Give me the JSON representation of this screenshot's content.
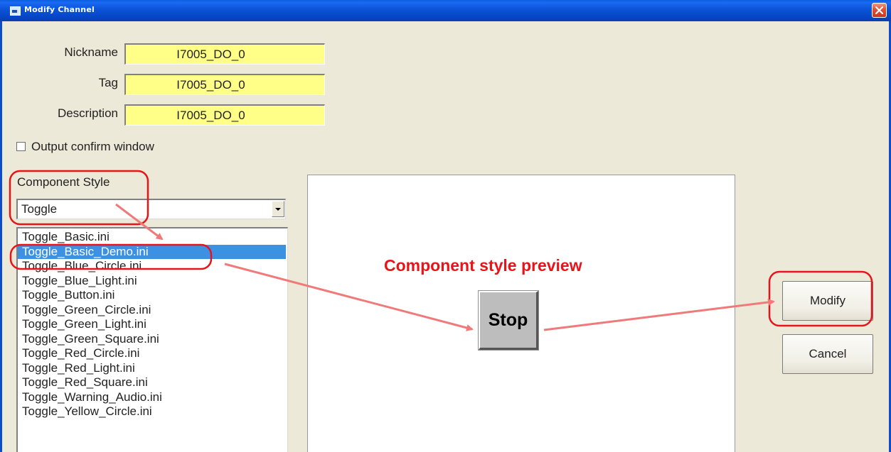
{
  "window": {
    "title": "Modify Channel"
  },
  "fields": {
    "nickname_label": "Nickname",
    "nickname_value": "I7005_DO_0",
    "tag_label": "Tag",
    "tag_value": "I7005_DO_0",
    "description_label": "Description",
    "description_value": "I7005_DO_0"
  },
  "output_confirm": {
    "label": "Output confirm window",
    "checked": false
  },
  "component_style": {
    "label": "Component Style",
    "selected": "Toggle",
    "files": [
      "Toggle_Basic.ini",
      "Toggle_Basic_Demo.ini",
      "Toggle_Blue_Circle.ini",
      "Toggle_Blue_Light.ini",
      "Toggle_Button.ini",
      "Toggle_Green_Circle.ini",
      "Toggle_Green_Light.ini",
      "Toggle_Green_Square.ini",
      "Toggle_Red_Circle.ini",
      "Toggle_Red_Light.ini",
      "Toggle_Red_Square.ini",
      "Toggle_Warning_Audio.ini",
      "Toggle_Yellow_Circle.ini"
    ],
    "selected_file_index": 1
  },
  "preview": {
    "caption": "Component style preview",
    "button_label": "Stop"
  },
  "buttons": {
    "modify": "Modify",
    "cancel": "Cancel"
  },
  "colors": {
    "field_background": "#ffff88",
    "selection": "#3c91e2",
    "annotation": "#e8141a",
    "arrow": "#f07a7a",
    "titlebar": "#0b52d6"
  }
}
